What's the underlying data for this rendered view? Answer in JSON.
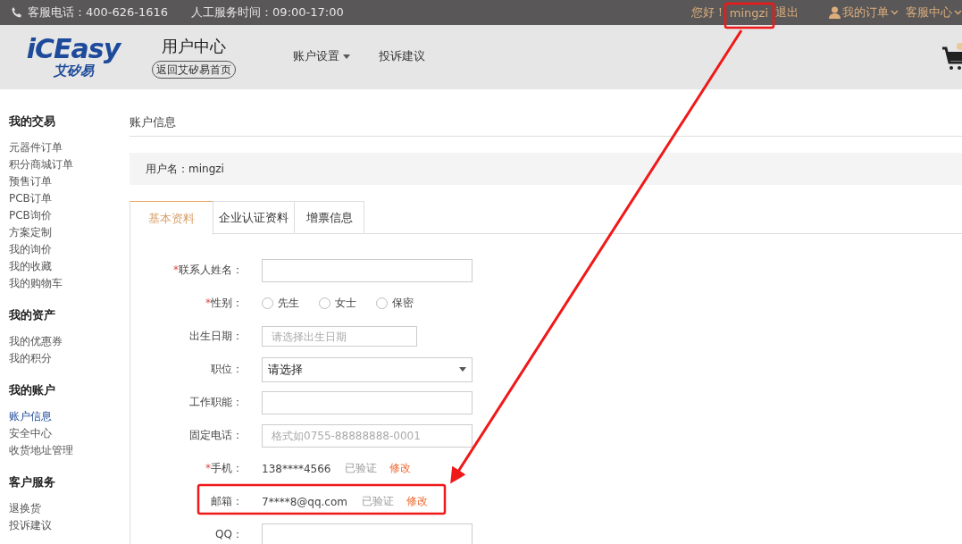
{
  "top_bar": {
    "hotline": "客服电话：400-626-1616",
    "service_hours": "人工服务时间：09:00-17:00",
    "greeting": "您好！",
    "username": "mingzi",
    "logout": "退出",
    "my_orders": "我的订单",
    "service_center": "客服中心"
  },
  "header": {
    "logo_text": "iCEasy",
    "logo_subtitle": "艾矽易",
    "title": "用户中心",
    "back_home": "返回艾矽易首页",
    "nav": [
      {
        "label": "账户设置",
        "dropdown": true
      },
      {
        "label": "投诉建议",
        "dropdown": false
      }
    ]
  },
  "sidebar": [
    {
      "title": "我的交易",
      "items": [
        {
          "label": "元器件订单",
          "selected": false
        },
        {
          "label": "积分商城订单",
          "selected": false
        },
        {
          "label": "预售订单",
          "selected": false
        },
        {
          "label": "PCB订单",
          "selected": false
        },
        {
          "label": "PCB询价",
          "selected": false
        },
        {
          "label": "方案定制",
          "selected": false
        },
        {
          "label": "我的询价",
          "selected": false
        },
        {
          "label": "我的收藏",
          "selected": false
        },
        {
          "label": "我的购物车",
          "selected": false
        }
      ]
    },
    {
      "title": "我的资产",
      "items": [
        {
          "label": "我的优惠券",
          "selected": false
        },
        {
          "label": "我的积分",
          "selected": false
        }
      ]
    },
    {
      "title": "我的账户",
      "items": [
        {
          "label": "账户信息",
          "selected": true
        },
        {
          "label": "安全中心",
          "selected": false
        },
        {
          "label": "收货地址管理",
          "selected": false
        }
      ]
    },
    {
      "title": "客户服务",
      "items": [
        {
          "label": "退换货",
          "selected": false
        },
        {
          "label": "投诉建议",
          "selected": false
        }
      ]
    }
  ],
  "page_title": "账户信息",
  "username_line": "用户名：mingzi",
  "tabs": [
    {
      "label": "基本资料",
      "selected": true
    },
    {
      "label": "企业认证资料",
      "selected": false
    },
    {
      "label": "增票信息",
      "selected": false
    }
  ],
  "form": [
    {
      "kind": "input",
      "mark": "*",
      "label": "联系人姓名："
    },
    {
      "kind": "radio",
      "mark": "*",
      "label": "性别：",
      "options": [
        {
          "label": "先生",
          "selected": false
        },
        {
          "label": "女士",
          "selected": false
        },
        {
          "label": "保密",
          "selected": false
        }
      ]
    },
    {
      "kind": "date",
      "label": "出生日期：",
      "placeholder": "请选择出生日期"
    },
    {
      "kind": "select",
      "label": "职位：",
      "value": "请选择"
    },
    {
      "kind": "input",
      "label": "工作职能："
    },
    {
      "kind": "input",
      "label": "固定电话：",
      "placeholder": "格式如0755-88888888-0001"
    },
    {
      "kind": "static",
      "mark": "*",
      "label": "手机：",
      "value": "138****4566",
      "status": "已验证",
      "action": "修改"
    },
    {
      "kind": "static",
      "label": "邮箱：",
      "value": "7****8@qq.com",
      "status": "已验证",
      "action": "修改"
    },
    {
      "kind": "input",
      "label": "QQ："
    }
  ]
}
